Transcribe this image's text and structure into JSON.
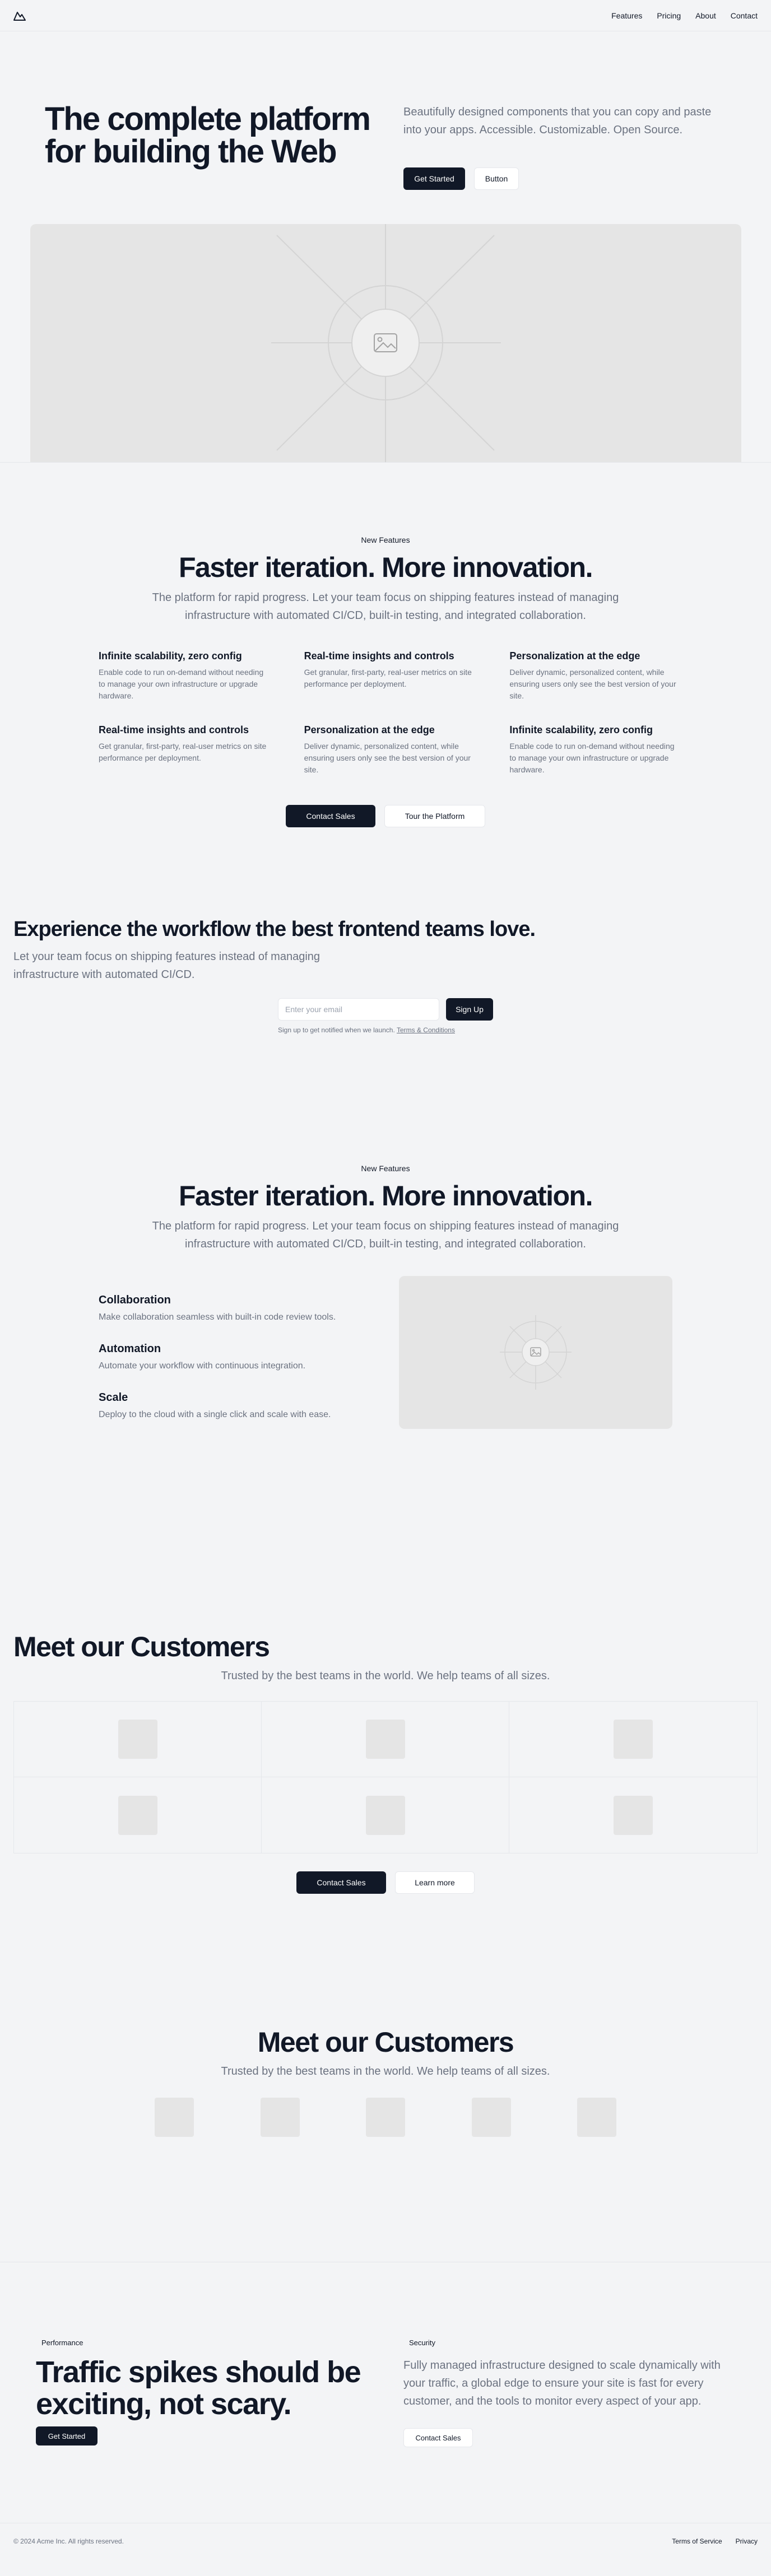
{
  "nav": {
    "logo_icon": "mountain-icon",
    "links": [
      "Features",
      "Pricing",
      "About",
      "Contact"
    ]
  },
  "hero": {
    "title": "The complete platform for building the Web",
    "text": "Beautifully designed components that you can copy and paste into your apps. Accessible. Customizable. Open Source.",
    "primary_button": "Get Started",
    "secondary_button": "Button",
    "image_icon": "image-placeholder-icon"
  },
  "features": {
    "eyebrow": "New Features",
    "title": "Faster iteration. More innovation.",
    "subtitle": "The platform for rapid progress. Let your team focus on shipping features instead of managing infrastructure with automated CI/CD, built-in testing, and integrated collaboration.",
    "items": [
      {
        "title": "Infinite scalability, zero config",
        "text": "Enable code to run on-demand without needing to manage your own infrastructure or upgrade hardware."
      },
      {
        "title": "Real-time insights and controls",
        "text": "Get granular, first-party, real-user metrics on site performance per deployment."
      },
      {
        "title": "Personalization at the edge",
        "text": "Deliver dynamic, personalized content, while ensuring users only see the best version of your site."
      },
      {
        "title": "Real-time insights and controls",
        "text": "Get granular, first-party, real-user metrics on site performance per deployment."
      },
      {
        "title": "Personalization at the edge",
        "text": "Deliver dynamic, personalized content, while ensuring users only see the best version of your site."
      },
      {
        "title": "Infinite scalability, zero config",
        "text": "Enable code to run on-demand without needing to manage your own infrastructure or upgrade hardware."
      }
    ],
    "primary_button": "Contact Sales",
    "secondary_button": "Tour the Platform"
  },
  "newsletter": {
    "title": "Experience the workflow the best frontend teams love.",
    "text": "Let your team focus on shipping features instead of managing infrastructure with automated CI/CD.",
    "input_placeholder": "Enter your email",
    "button": "Sign Up",
    "note_prefix": "Sign up to get notified when we launch.",
    "note_link": "Terms & Conditions"
  },
  "features2": {
    "eyebrow": "New Features",
    "title": "Faster iteration. More innovation.",
    "subtitle": "The platform for rapid progress. Let your team focus on shipping features instead of managing infrastructure with automated CI/CD, built-in testing, and integrated collaboration.",
    "items": [
      {
        "title": "Collaboration",
        "text": "Make collaboration seamless with built-in code review tools."
      },
      {
        "title": "Automation",
        "text": "Automate your workflow with continuous integration."
      },
      {
        "title": "Scale",
        "text": "Deploy to the cloud with a single click and scale with ease."
      }
    ]
  },
  "customers": {
    "title": "Meet our Customers",
    "subtitle": "Trusted by the best teams in the world. We help teams of all sizes.",
    "primary_button": "Contact Sales",
    "secondary_button": "Learn more"
  },
  "customers2": {
    "title": "Meet our Customers",
    "subtitle": "Trusted by the best teams in the world. We help teams of all sizes."
  },
  "cta": {
    "left_pill": "Performance",
    "title": "Traffic spikes should be exciting, not scary.",
    "left_button": "Get Started",
    "right_pill": "Security",
    "text": "Fully managed infrastructure designed to scale dynamically with your traffic, a global edge to ensure your site is fast for every customer, and the tools to monitor every aspect of your app.",
    "right_button": "Contact Sales"
  },
  "footer": {
    "copyright": "© 2024 Acme Inc. All rights reserved.",
    "links": [
      "Terms of Service",
      "Privacy"
    ]
  }
}
